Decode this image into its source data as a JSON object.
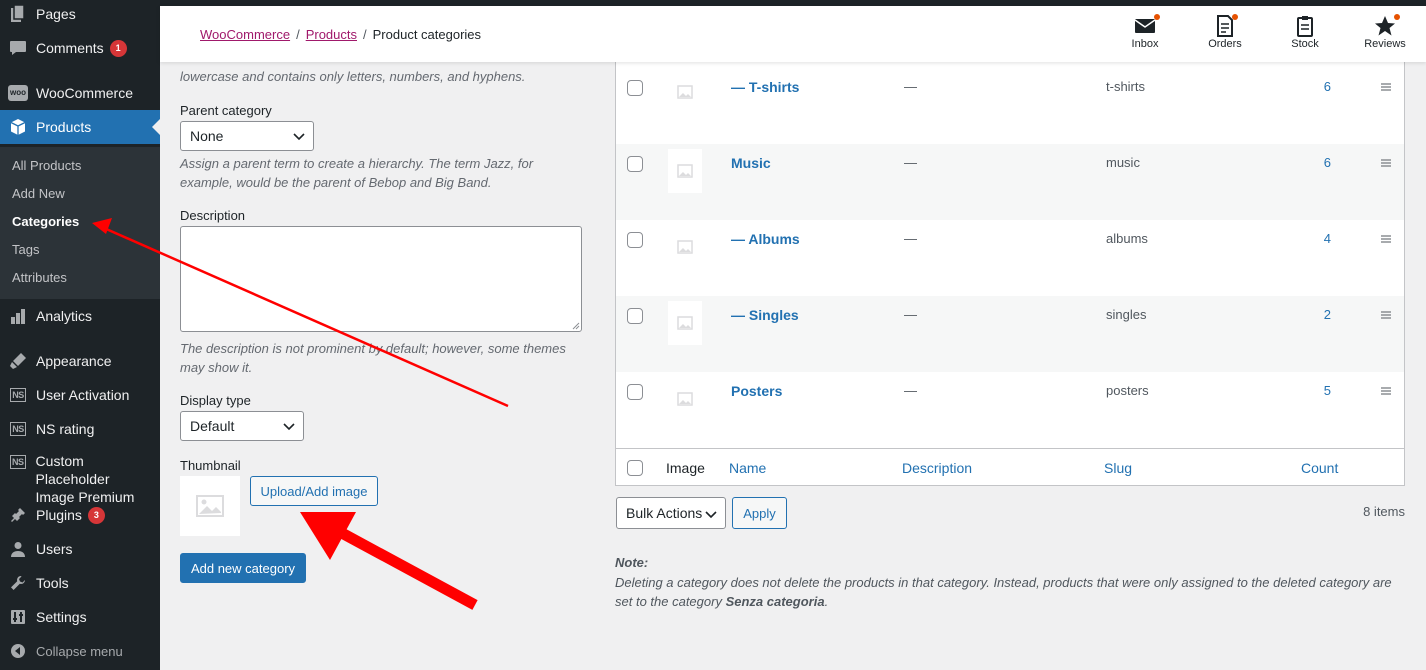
{
  "sidebar": {
    "items": [
      {
        "label": "Pages",
        "icon": "pages-icon"
      },
      {
        "label": "Comments",
        "icon": "comments-icon",
        "badge": "1"
      },
      {
        "label": "WooCommerce",
        "icon": "woocommerce-icon"
      },
      {
        "label": "Products",
        "icon": "products-icon"
      },
      {
        "label": "Analytics",
        "icon": "analytics-icon"
      },
      {
        "label": "Appearance",
        "icon": "appearance-icon"
      },
      {
        "label": "User Activation",
        "icon": "ns-icon"
      },
      {
        "label": "NS rating",
        "icon": "ns-icon"
      },
      {
        "label_line1": "Custom Placeholder",
        "label_line2": "Image Premium",
        "icon": "ns-icon"
      },
      {
        "label": "Plugins",
        "icon": "plugins-icon",
        "badge": "3"
      },
      {
        "label": "Users",
        "icon": "users-icon"
      },
      {
        "label": "Tools",
        "icon": "tools-icon"
      },
      {
        "label": "Settings",
        "icon": "settings-icon"
      }
    ],
    "woo_logo": "woo",
    "ns_logo": "NS",
    "submenu": [
      "All Products",
      "Add New",
      "Categories",
      "Tags",
      "Attributes"
    ],
    "collapse": "Collapse menu"
  },
  "header": {
    "breadcrumb": {
      "woocommerce": "WooCommerce",
      "products": "Products",
      "sep": "/",
      "current": "Product categories"
    },
    "buttons": [
      {
        "label": "Inbox",
        "icon": "inbox-icon"
      },
      {
        "label": "Orders",
        "icon": "orders-icon"
      },
      {
        "label": "Stock",
        "icon": "stock-icon"
      },
      {
        "label": "Reviews",
        "icon": "reviews-icon"
      }
    ]
  },
  "form": {
    "slug_hint": "lowercase and contains only letters, numbers, and hyphens.",
    "parent_label": "Parent category",
    "parent_value": "None",
    "parent_hint_1": "Assign a parent term to create a hierarchy. The term Jazz, for",
    "parent_hint_2": "example, would be the parent of Bebop and Big Band.",
    "description_label": "Description",
    "description_hint_1": "The description is not prominent by default; however, some themes",
    "description_hint_2": "may show it.",
    "display_label": "Display type",
    "display_value": "Default",
    "thumbnail_label": "Thumbnail",
    "upload_button": "Upload/Add image",
    "submit_button": "Add new category"
  },
  "table": {
    "rows": [
      {
        "name": "— T-shirts",
        "description": "—",
        "slug": "t-shirts",
        "count": "6"
      },
      {
        "name": "Music",
        "description": "—",
        "slug": "music",
        "count": "6"
      },
      {
        "name": "— Albums",
        "description": "—",
        "slug": "albums",
        "count": "4"
      },
      {
        "name": "— Singles",
        "description": "—",
        "slug": "singles",
        "count": "2"
      },
      {
        "name": "Posters",
        "description": "—",
        "slug": "posters",
        "count": "5"
      }
    ],
    "footer": {
      "image": "Image",
      "name": "Name",
      "description": "Description",
      "slug": "Slug",
      "count": "Count"
    },
    "bulk_actions": "Bulk Actions",
    "apply": "Apply",
    "items_count": "8 items",
    "note_title": "Note:",
    "note_text_1": "Deleting a category does not delete the products in that category. Instead, products that were only assigned to the deleted category are",
    "note_text_2": "set to the category ",
    "note_category": "Senza categoria",
    "note_end": "."
  },
  "colors": {
    "sidebar_bg": "#1d2327",
    "accent": "#2271b1",
    "breadcrumb_link": "#a0196b",
    "badge": "#d63638",
    "annotation_arrow": "#ff0000"
  }
}
